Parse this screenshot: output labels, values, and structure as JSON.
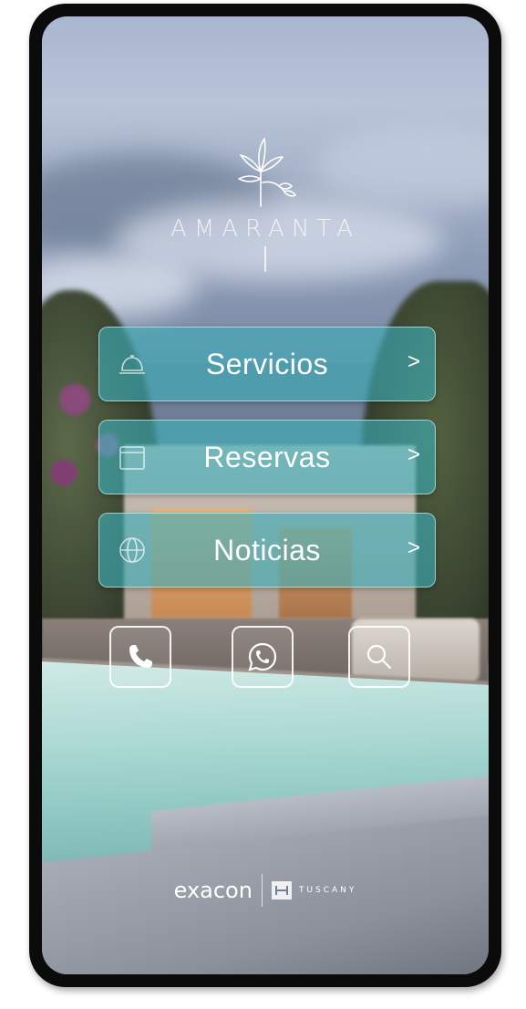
{
  "brand": {
    "name": "AMARANTA",
    "logo_icon": "leaf-branch-icon"
  },
  "menu": [
    {
      "label": "Servicios",
      "icon": "reception-bell-icon",
      "chevron": ">"
    },
    {
      "label": "Reservas",
      "icon": "calendar-icon",
      "chevron": ">"
    },
    {
      "label": "Noticias",
      "icon": "globe-icon",
      "chevron": ">"
    }
  ],
  "quick_actions": [
    {
      "icon": "phone-icon"
    },
    {
      "icon": "whatsapp-icon"
    },
    {
      "icon": "search-icon"
    }
  ],
  "footer": {
    "exacon": "exacon",
    "tuscany": "TUSCANY"
  },
  "colors": {
    "menu_button_fill": "#3cafb9",
    "text": "#ffffff",
    "frame": "#0b0b0b"
  }
}
